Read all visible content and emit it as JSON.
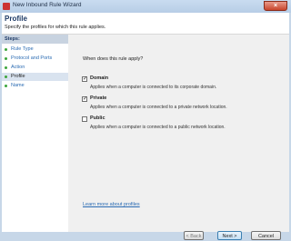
{
  "window": {
    "title": "New Inbound Rule Wizard",
    "close_glyph": "×"
  },
  "header": {
    "title": "Profile",
    "subtitle": "Specify the profiles for which this rule applies."
  },
  "steps": {
    "header": "Steps:",
    "items": [
      {
        "label": "Rule Type"
      },
      {
        "label": "Protocol and Ports"
      },
      {
        "label": "Action"
      },
      {
        "label": "Profile",
        "current": true
      },
      {
        "label": "Name"
      }
    ]
  },
  "main": {
    "question": "When does this rule apply?",
    "options": [
      {
        "label": "Domain",
        "checked": true,
        "description": "Applies when a computer is connected to its corporate domain."
      },
      {
        "label": "Private",
        "checked": true,
        "description": "Applies when a computer is connected to a private network location."
      },
      {
        "label": "Public",
        "checked": false,
        "description": "Applies when a computer is connected to a public network location."
      }
    ],
    "learn_more": "Learn more about profiles"
  },
  "buttons": {
    "back": "< Back",
    "next": "Next >",
    "cancel": "Cancel"
  },
  "colors": {
    "link": "#2a6bb3",
    "step_dot": "#3da53d",
    "title": "#1e3a66"
  }
}
